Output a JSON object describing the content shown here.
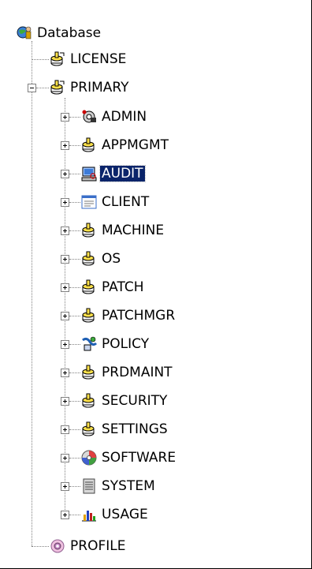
{
  "tree": {
    "root": {
      "label": "Database",
      "icon": "globe-person-icon"
    },
    "license": {
      "label": "LICENSE",
      "icon": "database-stack-icon"
    },
    "primary": {
      "label": "PRIMARY",
      "icon": "database-stack-icon",
      "expanded": true
    },
    "primary_children": [
      {
        "label": "ADMIN",
        "icon": "admin-gear-icon"
      },
      {
        "label": "APPMGMT",
        "icon": "database-stack-icon"
      },
      {
        "label": "AUDIT",
        "icon": "audit-computer-icon",
        "selected": true
      },
      {
        "label": "CLIENT",
        "icon": "client-window-icon"
      },
      {
        "label": "MACHINE",
        "icon": "database-stack-icon"
      },
      {
        "label": "OS",
        "icon": "database-stack-icon"
      },
      {
        "label": "PATCH",
        "icon": "database-stack-icon"
      },
      {
        "label": "PATCHMGR",
        "icon": "database-stack-icon"
      },
      {
        "label": "POLICY",
        "icon": "policy-icon"
      },
      {
        "label": "PRDMAINT",
        "icon": "database-stack-icon"
      },
      {
        "label": "SECURITY",
        "icon": "database-stack-icon"
      },
      {
        "label": "SETTINGS",
        "icon": "database-stack-icon"
      },
      {
        "label": "SOFTWARE",
        "icon": "software-disc-icon"
      },
      {
        "label": "SYSTEM",
        "icon": "system-server-icon"
      },
      {
        "label": "USAGE",
        "icon": "usage-bar-chart-icon"
      }
    ],
    "profile": {
      "label": "PROFILE",
      "icon": "profile-gears-icon"
    },
    "selection_color": "#0a246a"
  }
}
